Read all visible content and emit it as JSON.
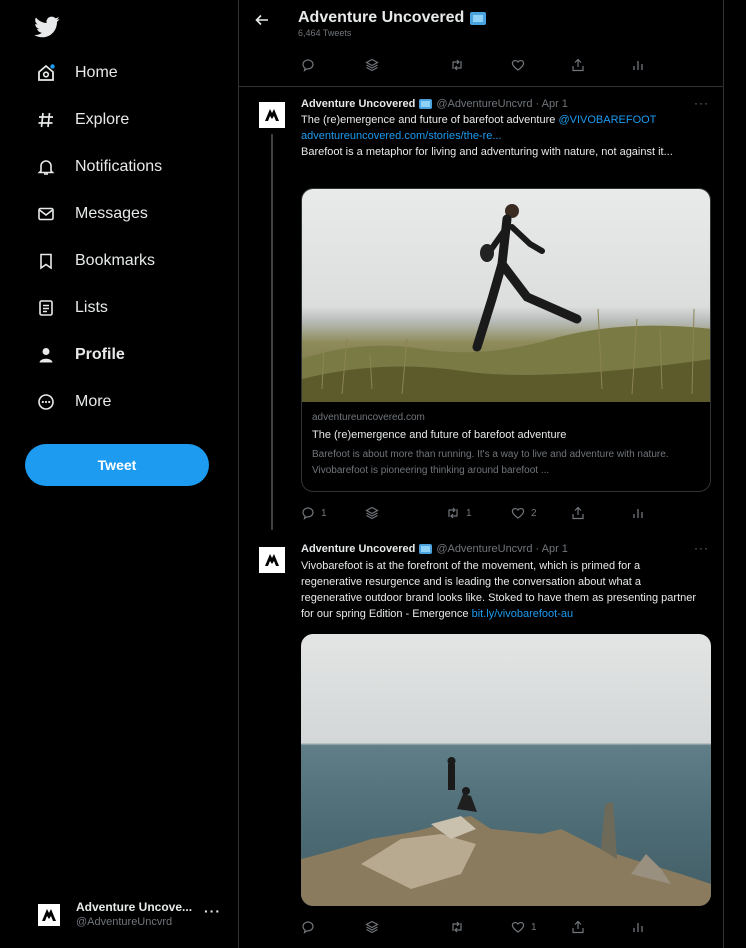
{
  "sidebar": {
    "nav": [
      {
        "label": "Home",
        "icon": "home-icon"
      },
      {
        "label": "Explore",
        "icon": "hashtag-icon"
      },
      {
        "label": "Notifications",
        "icon": "bell-icon"
      },
      {
        "label": "Messages",
        "icon": "envelope-icon"
      },
      {
        "label": "Bookmarks",
        "icon": "bookmark-icon"
      },
      {
        "label": "Lists",
        "icon": "list-icon"
      },
      {
        "label": "Profile",
        "icon": "person-icon"
      },
      {
        "label": "More",
        "icon": "more-circle-icon"
      }
    ],
    "tweet_button": "Tweet",
    "account": {
      "name": "Adventure Uncove...",
      "handle": "@AdventureUncvrd",
      "more": "···"
    }
  },
  "header": {
    "title": "Adventure Uncovered",
    "subtitle": "6,464 Tweets"
  },
  "tweets": [
    {
      "name": "Adventure Uncovered",
      "meta": "@AdventureUncvrd · Apr 1",
      "more": "···",
      "text_1": "The (re)emergence and future of barefoot adventure ",
      "mention": "@VIVOBAREFOOT",
      "link": "adventureuncovered.com/stories/the-re...",
      "text_2": "Barefoot is a metaphor for living and adventuring with nature, not against it...",
      "card": {
        "domain": "adventureuncovered.com",
        "title": "The (re)emergence and future of barefoot adventure",
        "description": "Barefoot is about more than running. It's a way to live and adventure with nature. Vivobarefoot is pioneering thinking around barefoot ..."
      },
      "actions": {
        "reply": "1",
        "retweet": "1",
        "like": "2"
      }
    },
    {
      "name": "Adventure Uncovered",
      "meta": "@AdventureUncvrd · Apr 1",
      "more": "···",
      "text": "Vivobarefoot is at the forefront of the movement, which is primed for a regenerative resurgence and is leading the conversation about what a regenerative outdoor brand looks like. Stoked to have them as presenting partner for our spring Edition - Emergence ",
      "link": "bit.ly/vivobarefoot-au",
      "actions": {
        "like": "1"
      }
    }
  ],
  "colors": {
    "accent": "#1d9bf0",
    "background": "#000000",
    "muted": "#71767b"
  }
}
